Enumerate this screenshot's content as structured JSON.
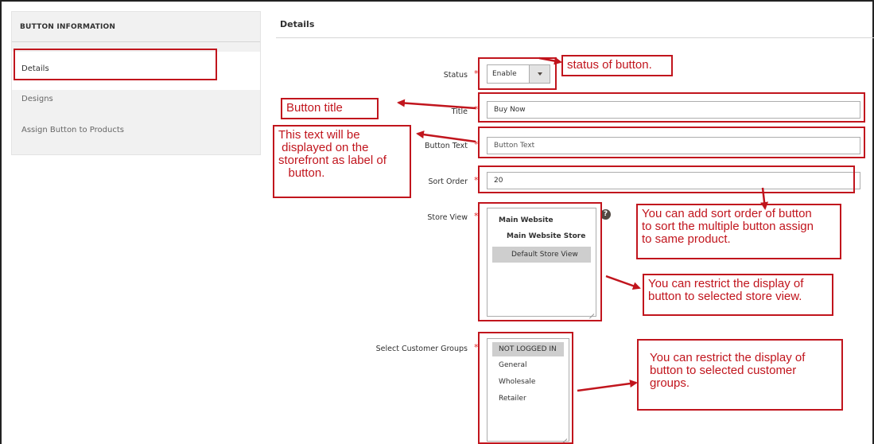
{
  "sidebar": {
    "heading": "BUTTON INFORMATION",
    "items": [
      {
        "label": "Details"
      },
      {
        "label": "Designs"
      },
      {
        "label": "Assign Button to Products"
      }
    ]
  },
  "main": {
    "section_title": "Details",
    "fields": {
      "status": {
        "label": "Status",
        "value": "Enable"
      },
      "title": {
        "label": "Title",
        "value": "Buy Now"
      },
      "button_text": {
        "label": "Button Text",
        "value": "Button Text"
      },
      "sort_order": {
        "label": "Sort Order",
        "value": "20"
      },
      "store_view": {
        "label": "Store View",
        "options": [
          "Main Website",
          "Main Website Store",
          "Default Store View"
        ],
        "help": "?"
      },
      "customer_groups": {
        "label": "Select Customer Groups",
        "options": [
          "NOT LOGGED IN",
          "General",
          "Wholesale",
          "Retailer"
        ]
      }
    },
    "required_mark": "*"
  },
  "annotations": {
    "status": "status of button.",
    "title": "Button title",
    "button_text": "This text will be\n displayed on the\nstorefront as label of\n   button.",
    "sort_order": "You can add sort order of button\nto sort the multiple button assign\nto same product.",
    "store_view": "You can restrict the display of\nbutton to selected store view.",
    "customer_groups": "You can restrict the display of\nbutton to selected customer\ngroups."
  },
  "colors": {
    "annotation": "#c1151d",
    "required": "#e22626",
    "selected_option": "#cecece"
  }
}
